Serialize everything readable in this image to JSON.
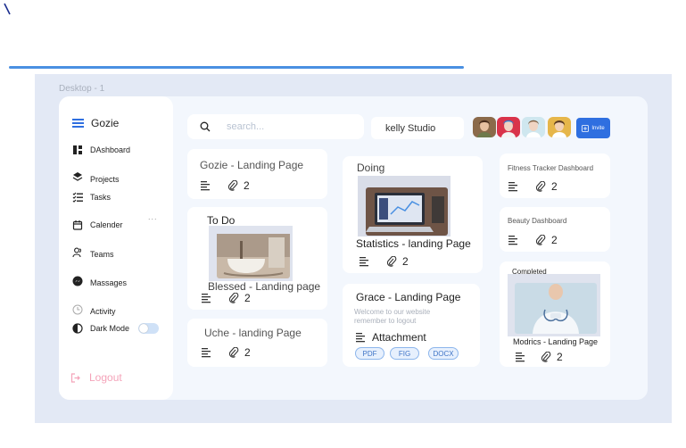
{
  "frame": {
    "label": "Desktop - 1"
  },
  "sidebar": {
    "brand": "Gozie",
    "items": [
      {
        "label": "DAshboard",
        "icon": "dashboard-icon"
      },
      {
        "label": "Projects",
        "icon": "projects-icon"
      },
      {
        "label": "Tasks",
        "icon": "tasks-icon"
      },
      {
        "label": "Calender",
        "icon": "calendar-icon"
      },
      {
        "label": "Teams",
        "icon": "teams-icon"
      },
      {
        "label": "Massages",
        "icon": "messenger-icon"
      },
      {
        "label": "Activity",
        "icon": "activity-icon"
      },
      {
        "label": "Dark Mode",
        "icon": "dark-mode-icon"
      }
    ],
    "more": "...",
    "dark_mode_on": false,
    "logout": "Logout"
  },
  "header": {
    "search_placeholder": "search...",
    "studio": "kelly Studio",
    "invite": "Invite"
  },
  "cards": {
    "gozie": {
      "title": "Gozie -  Landing Page",
      "attachments": "2"
    },
    "todo": {
      "heading": "To Do",
      "title": "Blessed - Landing page",
      "attachments": "2"
    },
    "uche": {
      "title": "Uche - landing Page",
      "attachments": "2"
    },
    "doing": {
      "heading": "Doing",
      "title": "Statistics - landing Page",
      "attachments": "2"
    },
    "grace": {
      "title": "Grace - Landing Page",
      "description_line1": "Welcome to our website",
      "description_line2": "remember to logout",
      "attachment_label": "Attachment",
      "tags": [
        "PDF",
        "FIG",
        "DOCX"
      ]
    },
    "fitness": {
      "title": "Fitness Tracker Dashboard",
      "attachments": "2"
    },
    "beauty": {
      "title": "Beauty Dashboard",
      "attachments": "2"
    },
    "completed": {
      "heading": "Completed",
      "title": "Modrics - Landing Page",
      "attachments": "2"
    }
  },
  "colors": {
    "accent": "#2f6fe0",
    "logout": "#f4a3b9",
    "frame": "#e3e9f5"
  }
}
